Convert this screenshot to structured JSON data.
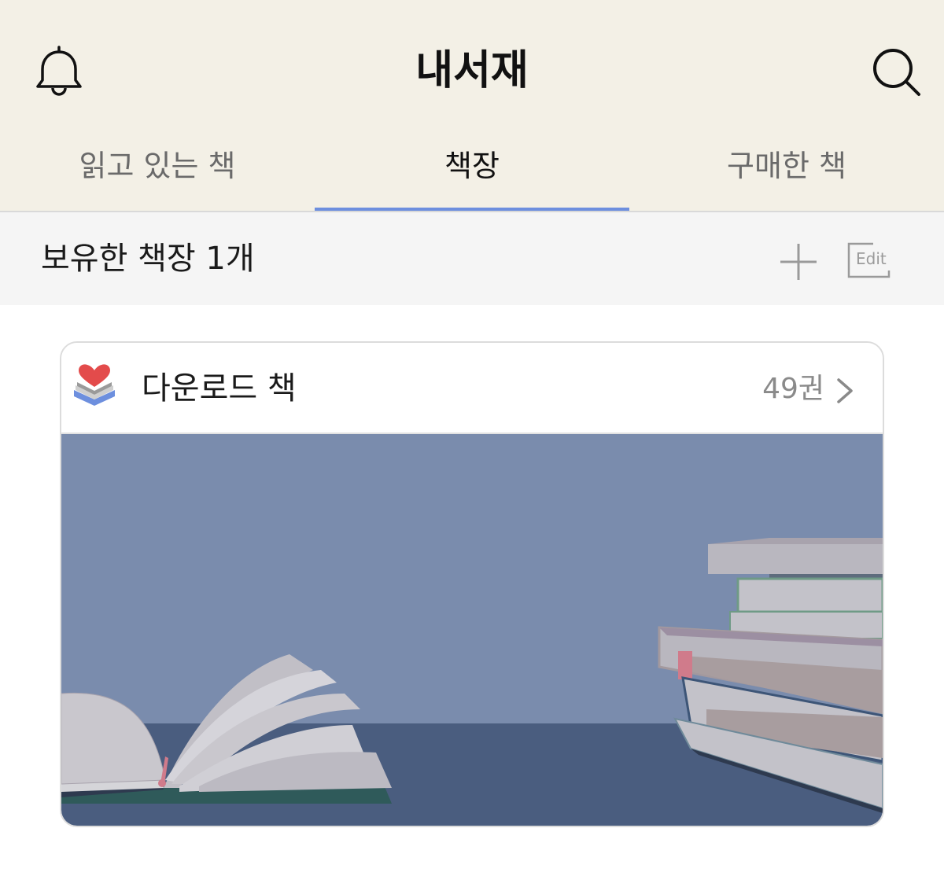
{
  "header": {
    "title": "내서재",
    "left_icon": "bell-icon",
    "right_icon": "search-icon"
  },
  "tabs": [
    {
      "label": "읽고 있는 책",
      "active": false
    },
    {
      "label": "책장",
      "active": true
    },
    {
      "label": "구매한 책",
      "active": false
    }
  ],
  "shelf_bar": {
    "title": "보유한 책장 1개",
    "add_icon": "plus-icon",
    "edit_label": "Edit"
  },
  "shelves": [
    {
      "name": "다운로드 책",
      "count": "49권",
      "icon": "heart-books-icon"
    }
  ],
  "colors": {
    "header_bg": "#f3f0e6",
    "tab_indicator": "#6d8fde",
    "cover_wall": "#7a8cad",
    "cover_table": "#4a5d7f"
  }
}
